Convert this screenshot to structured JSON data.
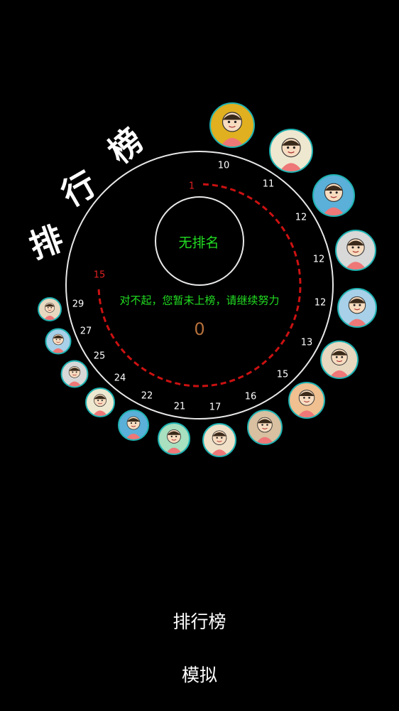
{
  "title_chars": [
    "排",
    "行",
    "榜"
  ],
  "center": {
    "no_rank_text": "无排名",
    "sorry_text": "对不起，您暂未上榜，请继续努力",
    "score": "0"
  },
  "progress": {
    "start_label": "1",
    "end_label": "15",
    "color": "#cc1111"
  },
  "ring_scores": [
    "10",
    "11",
    "12",
    "12",
    "12",
    "13",
    "15",
    "16",
    "17",
    "21",
    "22",
    "24",
    "25",
    "27",
    "29"
  ],
  "avatars": [
    {
      "name": "emoji-blush-avatar",
      "bg": "#e0b020"
    },
    {
      "name": "girl-pink-dress-avatar",
      "bg": "#efe8d0"
    },
    {
      "name": "blue-creature-avatar",
      "bg": "#5ab0d8"
    },
    {
      "name": "anime-boy-avatar",
      "bg": "#d8d8d8"
    },
    {
      "name": "bunny-sketch-avatar",
      "bg": "#a8d0e8"
    },
    {
      "name": "girl-black-hair-avatar",
      "bg": "#e8d8c0"
    },
    {
      "name": "cartoon-boy-avatar",
      "bg": "#f0c090"
    },
    {
      "name": "plush-bear-avatar",
      "bg": "#d8c0a0"
    },
    {
      "name": "girl-red-hair-avatar",
      "bg": "#f0e0c8"
    },
    {
      "name": "boy-green-shirt-avatar",
      "bg": "#a8e0c0"
    },
    {
      "name": "blue-creature-small-avatar",
      "bg": "#5ab0d8"
    },
    {
      "name": "girl-small-avatar",
      "bg": "#efe8d0"
    },
    {
      "name": "anime-boy-small-avatar",
      "bg": "#d8d8d8"
    },
    {
      "name": "bunny-sketch-small-avatar",
      "bg": "#a8d0e8"
    },
    {
      "name": "girl-black-hair-small-avatar",
      "bg": "#e8d8c0"
    }
  ],
  "buttons": {
    "leaderboard": "排行榜",
    "simulate": "模拟"
  },
  "colors": {
    "accent_green": "#22dd22",
    "avatar_border": "#1fb3b3",
    "score_brown": "#b5703a"
  }
}
